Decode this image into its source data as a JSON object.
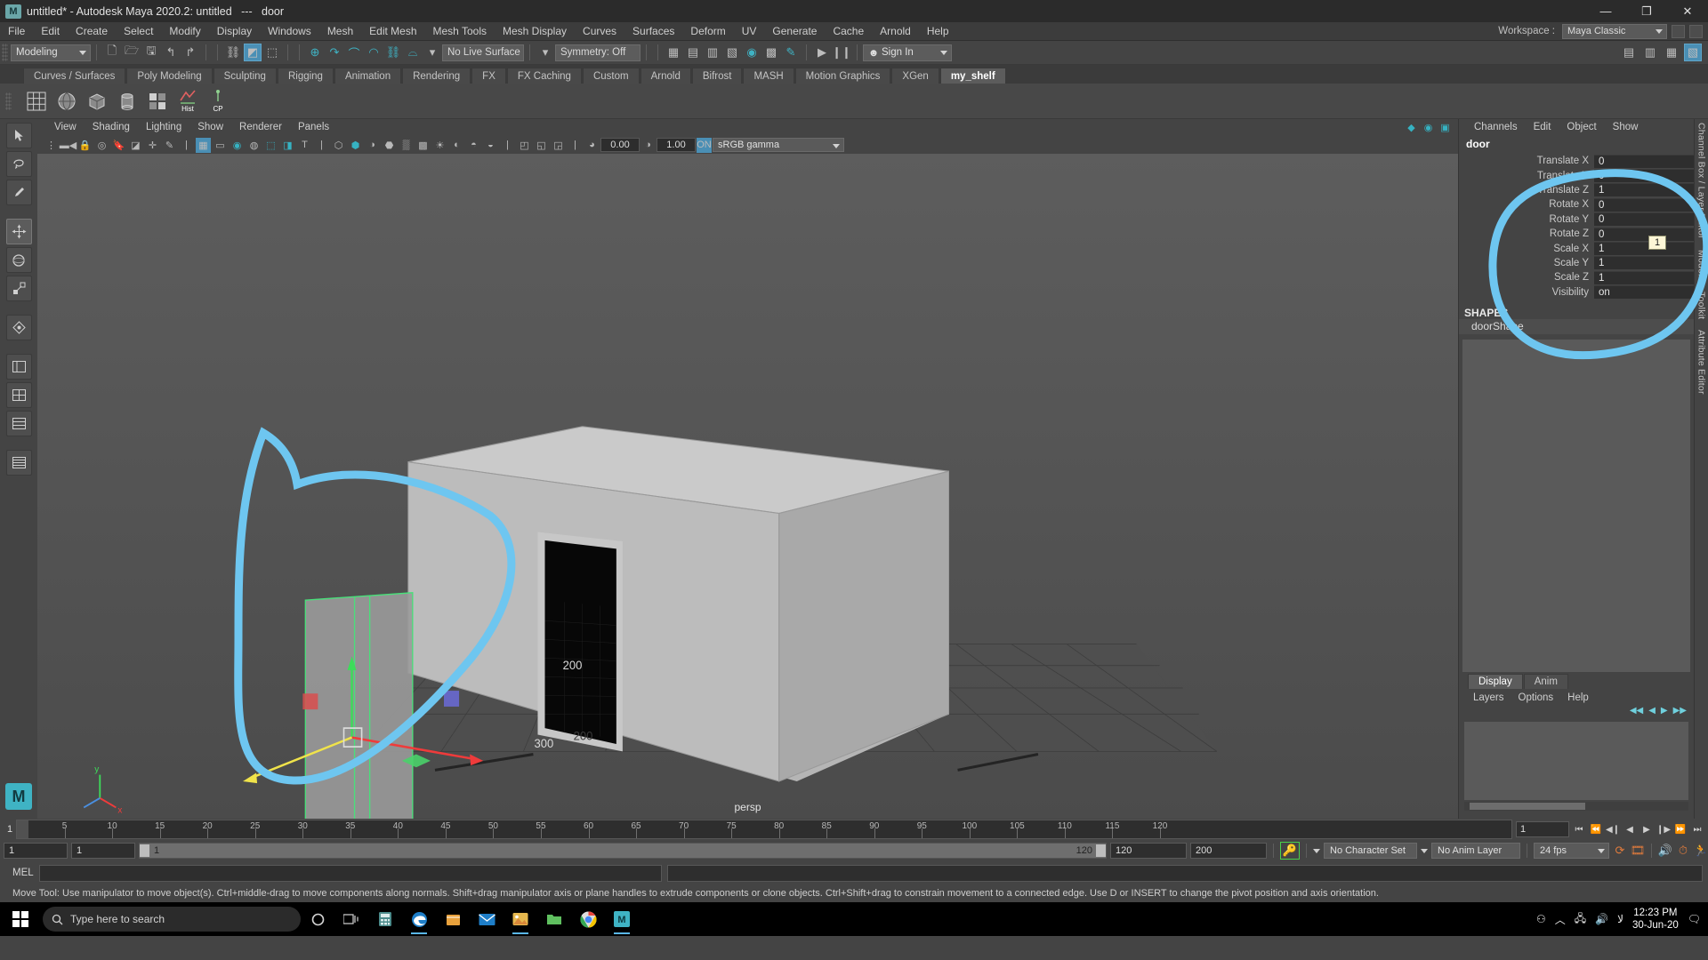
{
  "window": {
    "title": "untitled* - Autodesk Maya 2020.2: untitled   ---   door",
    "logo": "maya-logo",
    "buttons": {
      "minimize": "—",
      "maximize": "❐",
      "close": "✕"
    }
  },
  "menubar": {
    "items": [
      "File",
      "Edit",
      "Create",
      "Select",
      "Modify",
      "Display",
      "Windows",
      "Mesh",
      "Edit Mesh",
      "Mesh Tools",
      "Mesh Display",
      "Curves",
      "Surfaces",
      "Deform",
      "UV",
      "Generate",
      "Cache",
      "Arnold",
      "Help"
    ],
    "workspace_label": "Workspace :",
    "workspace_value": "Maya Classic"
  },
  "statusbar": {
    "mode": "Modeling",
    "live_surface": "No Live Surface",
    "symmetry": "Symmetry: Off",
    "signin": "Sign In",
    "icons": [
      "new-scene-icon",
      "open-scene-icon",
      "save-scene-icon",
      "undo-icon",
      "redo-icon",
      "select-hierarchy-icon",
      "select-object-icon",
      "select-component-icon",
      "snap-grid-icon",
      "snap-curve-icon",
      "snap-point-icon",
      "snap-projected-center-icon",
      "snap-view-plane-icon",
      "snap-make-live-icon",
      "show-hide-render-view-icon",
      "render-current-frame-icon",
      "ipr-render-icon",
      "render-settings-icon",
      "hypershade-icon",
      "render-sequence-icon",
      "toggle-brush-icon",
      "playblast-icon",
      "pause-icon",
      "animation-icon"
    ]
  },
  "shelf": {
    "tabs": [
      "Curves / Surfaces",
      "Poly Modeling",
      "Sculpting",
      "Rigging",
      "Animation",
      "Rendering",
      "FX",
      "FX Caching",
      "Custom",
      "Arnold",
      "Bifrost",
      "MASH",
      "Motion Graphics",
      "XGen",
      "my_shelf"
    ],
    "active_tab": "my_shelf",
    "buttons": [
      {
        "name": "grid-shelf-icon",
        "label": ""
      },
      {
        "name": "polygon-sphere-icon",
        "label": ""
      },
      {
        "name": "polygon-cube-icon",
        "label": ""
      },
      {
        "name": "polygon-cylinder-icon",
        "label": ""
      },
      {
        "name": "grid-divide-icon",
        "label": ""
      },
      {
        "name": "hist-shelf-icon",
        "label": "Hist"
      },
      {
        "name": "cp-shelf-icon",
        "label": "CP"
      }
    ]
  },
  "toolbox": {
    "tools": [
      "select-tool",
      "lasso-select-tool",
      "paint-select-tool",
      "move-tool",
      "rotate-tool",
      "scale-tool",
      "last-tool-used",
      "show-manipulator-tool",
      "outliner-panel-layout",
      "persp-outliner-layout",
      "single-persp-layout",
      "four-view-layout",
      "hypergraph-layout"
    ],
    "badge": "M"
  },
  "viewport": {
    "menus": [
      "View",
      "Shading",
      "Lighting",
      "Show",
      "Renderer",
      "Panels"
    ],
    "camera_label": "persp",
    "exposure": "0.00",
    "gamma_value": "1.00",
    "color_space": "sRGB gamma",
    "toolbar_icons": [
      "select-camera-icon",
      "lock-camera-icon",
      "camera-attributes-icon",
      "bookmark-icon",
      "image-plane-icon",
      "grease-pencil-icon",
      "two-d-pan-zoom-icon",
      "grid-toggle-icon",
      "film-gate-icon",
      "resolution-gate-icon",
      "gate-mask-icon",
      "film-origin-icon",
      "exposure-icon",
      "hud-icon",
      "wireframe-icon",
      "smooth-shade-icon",
      "shaded-wireframe-icon",
      "flat-shade-icon",
      "xray-icon",
      "texture-toggle-icon",
      "lighting-toggle-icon",
      "shadows-icon",
      "ao-icon",
      "aa-icon",
      "motion-blur-icon",
      "isolate-select-icon"
    ],
    "grid_labels": [
      "200",
      "200",
      "300"
    ]
  },
  "channelbox": {
    "menus": [
      "Channels",
      "Edit",
      "Object",
      "Show"
    ],
    "object_name": "door",
    "rows": [
      {
        "label": "Translate X",
        "value": "0"
      },
      {
        "label": "Translate Y",
        "value": "0"
      },
      {
        "label": "Translate Z",
        "value": "1"
      },
      {
        "label": "Rotate X",
        "value": "0"
      },
      {
        "label": "Rotate Y",
        "value": "0"
      },
      {
        "label": "Rotate Z",
        "value": "0"
      },
      {
        "label": "Scale X",
        "value": "1"
      },
      {
        "label": "Scale Y",
        "value": "1"
      },
      {
        "label": "Scale Z",
        "value": "1"
      },
      {
        "label": "Visibility",
        "value": "on"
      }
    ],
    "shapes_header": "SHAPES",
    "shape_name": "doorShape",
    "tooltip_value": "1"
  },
  "layer_editor": {
    "tabs": [
      "Display",
      "Anim"
    ],
    "active_tab": "Display",
    "menus": [
      "Layers",
      "Options",
      "Help"
    ],
    "icons": [
      "layer-first-icon",
      "layer-prev-icon",
      "layer-next-icon",
      "layer-last-icon"
    ]
  },
  "dock": {
    "labels": [
      "Channel Box / Layer Editor",
      "Modeling Toolkit",
      "Attribute Editor"
    ]
  },
  "timeline": {
    "current_frame": "1",
    "ticks": [
      5,
      10,
      15,
      20,
      25,
      30,
      35,
      40,
      45,
      50,
      55,
      60,
      65,
      70,
      75,
      80,
      85,
      90,
      95,
      100,
      105,
      110,
      115,
      120
    ],
    "frame_field": "1",
    "playback_buttons": [
      "go-to-start-icon",
      "step-back-key-icon",
      "step-back-frame-icon",
      "play-backwards-icon",
      "play-forwards-icon",
      "step-forward-frame-icon",
      "step-forward-key-icon",
      "go-to-end-icon"
    ],
    "range_start": "1",
    "range_start_2": "1",
    "range_bar_min": "1",
    "range_bar_max": "120",
    "range_end": "120",
    "playback_end": "200",
    "auto_key": "auto-keyframe-icon",
    "character_set": "No Character Set",
    "anim_layer": "No Anim Layer",
    "fps": "24 fps",
    "right_icons": [
      "cycle-playback-icon",
      "playblast-icon",
      "audio-icon",
      "anim-prefs-icon",
      "character-icon"
    ]
  },
  "command_line": {
    "label": "MEL",
    "input_value": "",
    "output_value": ""
  },
  "help_line": {
    "text": "Move Tool: Use manipulator to move object(s). Ctrl+middle-drag to move components along normals. Shift+drag manipulator axis or plane handles to extrude components or clone objects. Ctrl+Shift+drag to constrain movement to a connected edge. Use D or INSERT to change the pivot position and axis orientation."
  },
  "taskbar": {
    "search_placeholder": "Type here to search",
    "search_icon": "search-icon",
    "start_icon": "windows-start-icon",
    "apps": [
      "cortana-icon",
      "task-view-icon",
      "calculator-icon",
      "edge-icon",
      "store-icon",
      "mail-icon",
      "photos-icon",
      "files-icon",
      "chrome-icon",
      "maya-icon"
    ],
    "tray": [
      "people-icon",
      "show-hidden-icon",
      "network-icon",
      "volume-icon",
      "language-icon"
    ],
    "language": "لا",
    "time": "12:23 PM",
    "date": "30-Jun-20",
    "notifications_icon": "notification-icon"
  },
  "annotation": {
    "color": "#6ec6f0",
    "shapes": [
      "circle-around-channelbox",
      "circle-around-door-object"
    ]
  },
  "colors": {
    "accent_teal": "#3fb3c4",
    "highlight_blue": "#4a8fb5",
    "annotation_blue": "#6ec6f0",
    "panel_bg": "#444444",
    "field_bg": "#2e2e2e"
  }
}
